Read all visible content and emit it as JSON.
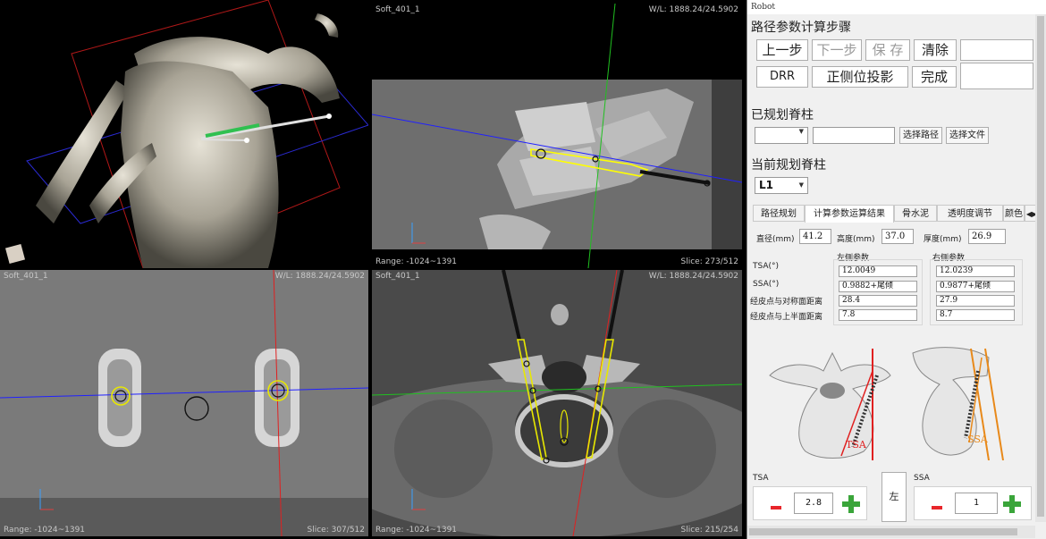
{
  "views": {
    "top_right": {
      "name": "Soft_401_1",
      "wl": "W/L: 1888.24/24.5902",
      "range": "Range: -1024~1391",
      "slice": "Slice: 273/512"
    },
    "bottom_left": {
      "name": "Soft_401_1",
      "wl": "W/L: 1888.24/24.5902",
      "range": "Range: -1024~1391",
      "slice": "Slice: 307/512"
    },
    "bottom_right": {
      "name": "Soft_401_1",
      "wl": "W/L: 1888.24/24.5902",
      "range": "Range: -1024~1391",
      "slice": "Slice: 215/254"
    }
  },
  "panel": {
    "window_title": "Robot",
    "steps_heading": "路径参数计算步骤",
    "buttons": {
      "prev": "上一步",
      "next": "下一步",
      "save": "保 存",
      "clear": "清除",
      "drr": "DRR",
      "projection": "正侧位投影",
      "finish": "完成"
    },
    "planned_heading": "已规划脊柱",
    "select_path": "选择路径",
    "select_file": "选择文件",
    "current_heading": "当前规划脊柱",
    "current_spine": "L1",
    "tabs": [
      "路径规划",
      "计算参数运算结果",
      "骨水泥",
      "透明度调节",
      "颜色"
    ],
    "diameter_label": "直径(mm)",
    "diameter_value": "41.2",
    "height_label": "高度(mm)",
    "height_value": "37.0",
    "thickness_label": "厚度(mm)",
    "thickness_value": "26.9",
    "left_params": "左侧参数",
    "right_params": "右侧参数",
    "row_labels": [
      "TSA(°)",
      "SSA(°)",
      "经皮点与对称面距离",
      "经皮点与上半面距离"
    ],
    "left_values": [
      "12.0049",
      "0.9882+尾倾",
      "28.4",
      "7.8"
    ],
    "right_values": [
      "12.0239",
      "0.9877+尾倾",
      "27.9",
      "8.7"
    ],
    "tsa_label": "TSA",
    "ssa_label": "SSA",
    "tsa_value": "2.8",
    "ssa_value": "1",
    "side_label": "左",
    "diagram_tsa": "TSA",
    "diagram_ssa": "SSA"
  }
}
